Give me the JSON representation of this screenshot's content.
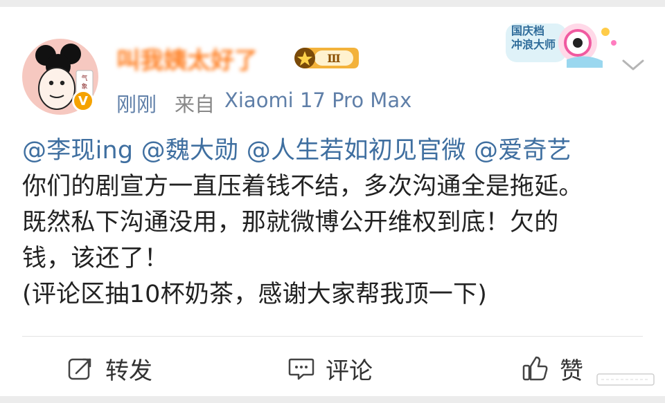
{
  "post": {
    "author": {
      "display_name": "叫我姨太好了",
      "level_badge": "Ⅲ",
      "avatar_text": "气 象 煤",
      "verified_badge": "V"
    },
    "meta": {
      "time": "刚刚",
      "source_prefix": "来自",
      "device": "Xiaomi 17 Pro Max"
    },
    "event_badge": {
      "text": "国庆档\n冲浪大师"
    },
    "mentions": [
      "@李现ing",
      "@魏大勋",
      "@人生若如初见官微",
      "@爱奇艺"
    ],
    "content_lines": [
      "你们的剧宣方一直压着钱不结，多次沟通全是拖延。",
      "既然私下沟通没用，那就微博公开维权到底！欠的",
      "钱，该还了！",
      "(评论区抽10杯奶茶，感谢大家帮我顶一下)"
    ]
  },
  "actions": {
    "repost_label": "转发",
    "comment_label": "评论",
    "like_label": "赞"
  },
  "colors": {
    "link": "#3f6fa0",
    "time": "#5f7fa8",
    "username": "#ff7a1a",
    "text": "#222222"
  }
}
